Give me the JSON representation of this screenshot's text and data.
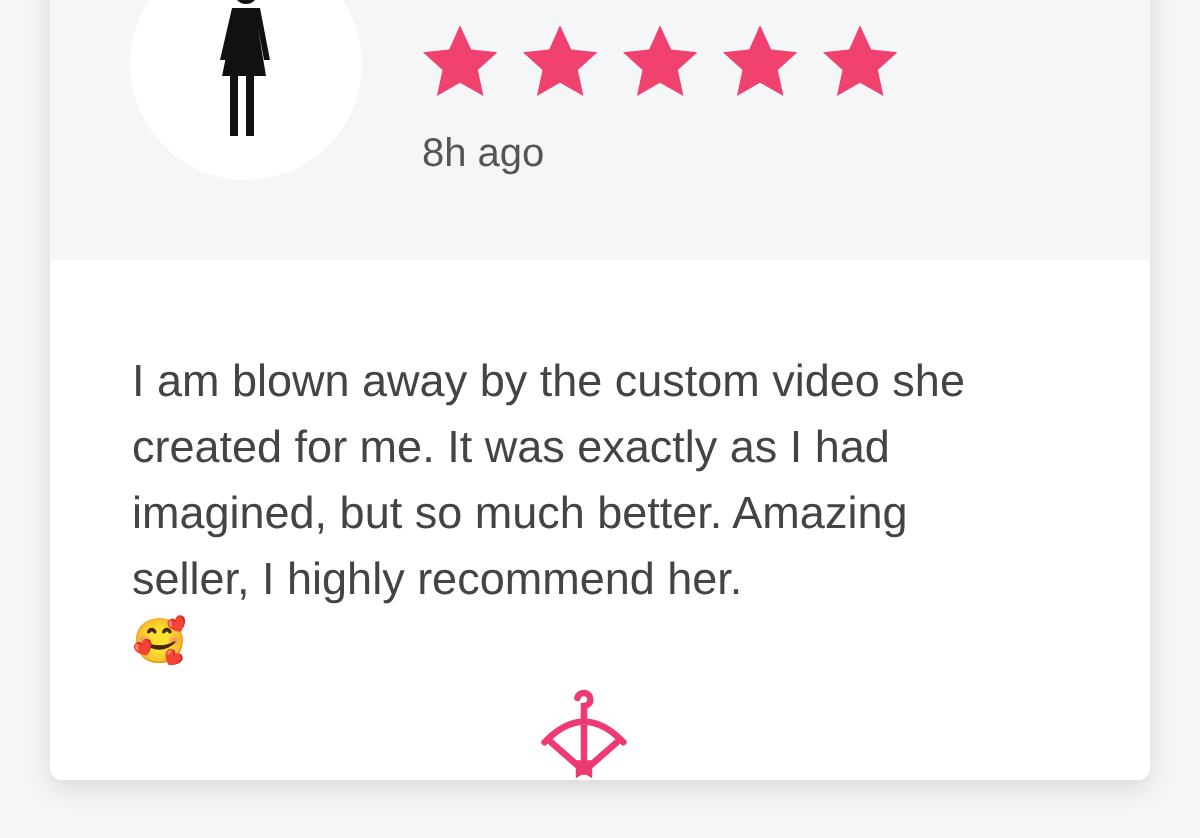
{
  "review": {
    "stars": 5,
    "time": "8h ago",
    "text": "I am blown away by the custom video she created for me. It was exactly as I had imagined, but so much better. Amazing seller, I highly recommend her.",
    "emoji": "🥰"
  }
}
